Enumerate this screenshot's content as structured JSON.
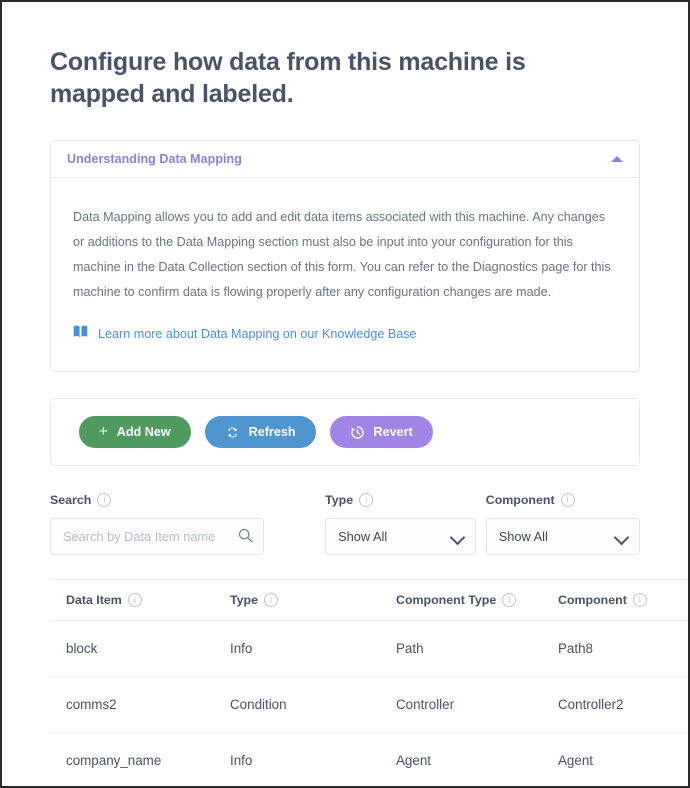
{
  "page": {
    "title": "Configure how data from this machine is mapped and labeled."
  },
  "accordion": {
    "title": "Understanding Data Mapping",
    "collapse_icon": "caret-up-icon",
    "body_text": "Data Mapping allows you to add and edit data items associated with this machine. Any changes or additions to the Data Mapping section must also be input into your configuration for this machine in the Data Collection section of this form. You can refer to the Diagnostics page for this machine to confirm data is flowing properly after any configuration changes are made.",
    "link": {
      "icon": "book-icon",
      "label": "Learn more about Data Mapping on our Knowledge Base"
    }
  },
  "toolbar": {
    "add_new": {
      "label": "Add New",
      "icon": "plus-icon",
      "color": "#4e9a5f"
    },
    "refresh": {
      "label": "Refresh",
      "icon": "refresh-icon",
      "color": "#4f96d1"
    },
    "revert": {
      "label": "Revert",
      "icon": "history-icon",
      "color": "#a284e6"
    }
  },
  "filters": {
    "search": {
      "label": "Search",
      "info_icon": "info-icon",
      "placeholder": "Search by Data Item name",
      "value": "",
      "icon": "search-icon"
    },
    "type": {
      "label": "Type",
      "info_icon": "info-icon",
      "selected": "Show All",
      "chevron": "chevron-down-icon"
    },
    "component": {
      "label": "Component",
      "info_icon": "info-icon",
      "selected": "Show All",
      "chevron": "chevron-down-icon"
    }
  },
  "table": {
    "columns": [
      {
        "label": "Data Item",
        "info_icon": "info-icon"
      },
      {
        "label": "Type",
        "info_icon": "info-icon"
      },
      {
        "label": "Component Type",
        "info_icon": "info-icon"
      },
      {
        "label": "Component",
        "info_icon": "info-icon"
      }
    ],
    "rows": [
      {
        "data_item": "block",
        "type": "Info",
        "component_type": "Path",
        "component": "Path8"
      },
      {
        "data_item": "comms2",
        "type": "Condition",
        "component_type": "Controller",
        "component": "Controller2"
      },
      {
        "data_item": "company_name",
        "type": "Info",
        "component_type": "Agent",
        "component": "Agent"
      }
    ]
  },
  "colors": {
    "accent_purple": "#8a7ee8",
    "link_blue": "#4a90d9",
    "text": "#4a5168"
  }
}
